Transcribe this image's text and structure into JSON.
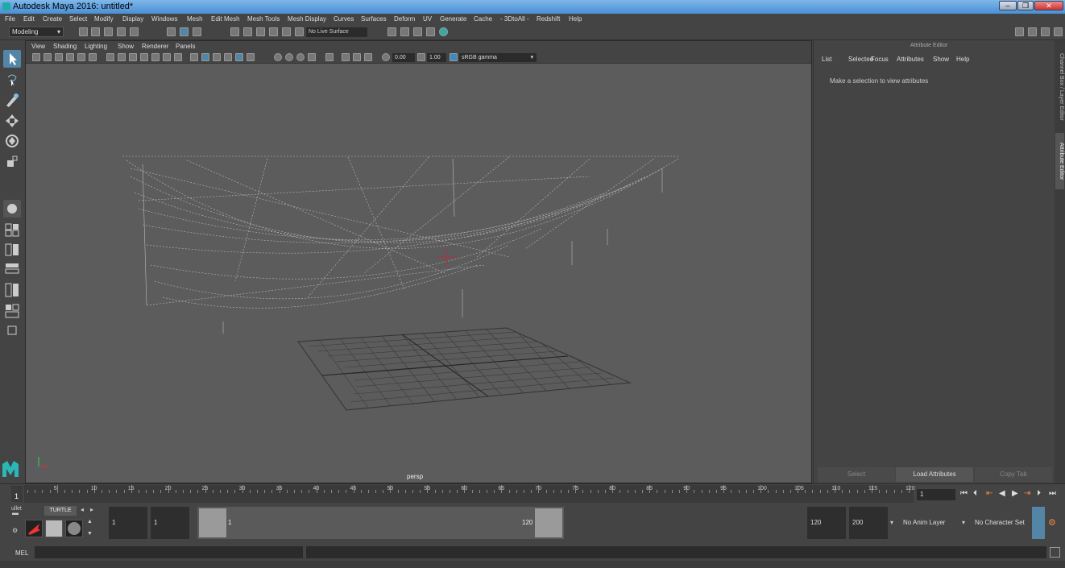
{
  "window": {
    "title": "Autodesk Maya 2016: untitled*"
  },
  "menubar": [
    "File",
    "Edit",
    "Create",
    "Select",
    "Modify",
    "Display",
    "Windows",
    "Mesh",
    "Edit Mesh",
    "Mesh Tools",
    "Mesh Display",
    "Curves",
    "Surfaces",
    "Deform",
    "UV",
    "Generate",
    "Cache",
    "- 3DtoAll -",
    "Redshift",
    "Help"
  ],
  "shelf": {
    "mode": "Modeling",
    "live_surface": "No Live Surface"
  },
  "viewport": {
    "menu": [
      "View",
      "Shading",
      "Lighting",
      "Show",
      "Renderer",
      "Panels"
    ],
    "exposure": "0.00",
    "gamma": "1.00",
    "color_space": "sRGB gamma",
    "camera": "persp"
  },
  "attribute_editor": {
    "title": "Attribute Editor",
    "menu": [
      "List",
      "Selected",
      "Focus",
      "Attributes",
      "Show",
      "Help"
    ],
    "message": "Make a selection to view attributes",
    "buttons": {
      "select": "Select",
      "load": "Load Attributes",
      "copy": "Copy Tab"
    }
  },
  "side_tabs": {
    "channel": "Channel Box / Layer Editor",
    "attribute": "Attribute Editor"
  },
  "timeline": {
    "labels": [
      "1",
      "5",
      "10",
      "15",
      "20",
      "25",
      "30",
      "35",
      "40",
      "45",
      "50",
      "55",
      "60",
      "65",
      "70",
      "75",
      "80",
      "85",
      "90",
      "95",
      "100",
      "105",
      "110",
      "115",
      "120"
    ],
    "current_frame": "1"
  },
  "range": {
    "shelf_tabs": {
      "tab1": "ullet",
      "tab2": "TURTLE"
    },
    "start": "1",
    "anim_start": "1",
    "slider_start": "1",
    "slider_end": "120",
    "anim_end": "120",
    "end": "200",
    "anim_layer": "No Anim Layer",
    "character_set": "No Character Set"
  },
  "cmdline": {
    "label": "MEL"
  }
}
